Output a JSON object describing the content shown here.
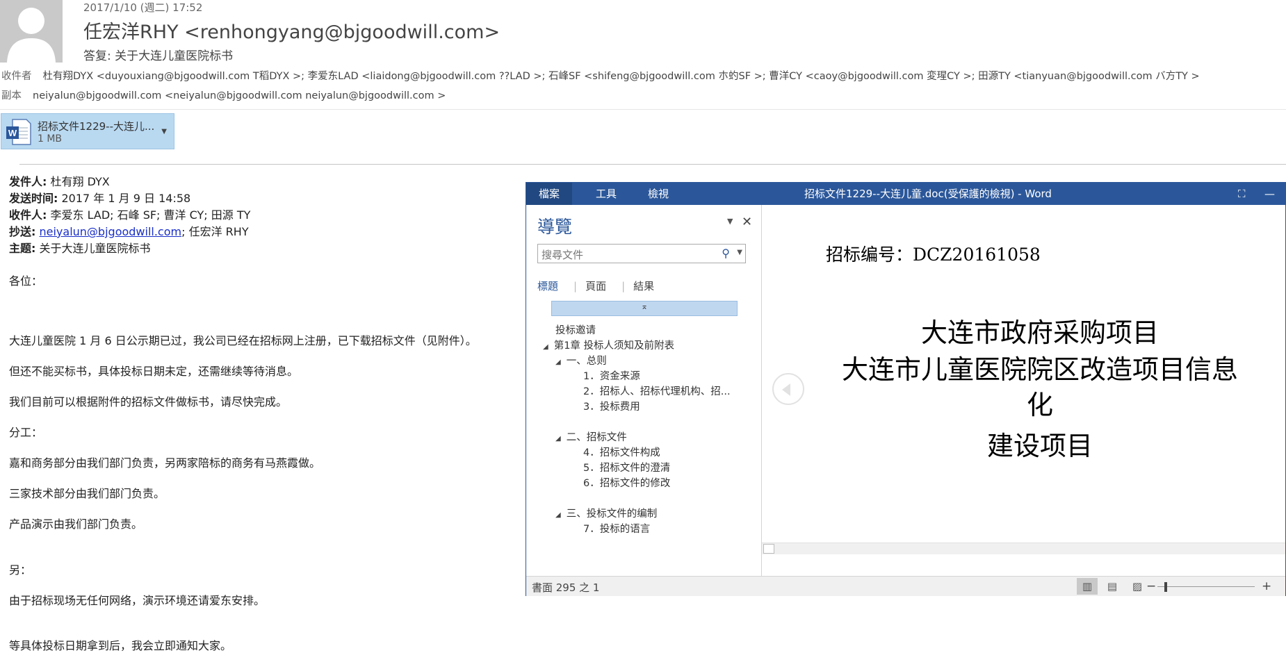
{
  "email": {
    "datetime": "2017/1/10 (週二) 17:52",
    "sender": "任宏洋RHY <renhongyang@bjgoodwill.com>",
    "subject": "答复: 关于大连儿童医院标书",
    "to_label": "收件者",
    "to_value": "杜有翔DYX <duyouxiang@bjgoodwill.com    T稻DYX >; 李爱东LAD <liaidong@bjgoodwill.com    ??LAD >; 石峰SF <shifeng@bjgoodwill.com 朩虳SF >; 曹洋CY <caoy@bjgoodwill.com 変瑆CY >; 田源TY <tianyuan@bjgoodwill.com バ方TY >",
    "cc_label": "副本",
    "cc_value": "neiyalun@bjgoodwill.com <neiyalun@bjgoodwill.com neiyalun@bjgoodwill.com >",
    "attachment": {
      "name": "招标文件1229--大连儿...",
      "size": "1 MB"
    },
    "quoted": {
      "from_label": "发件人:",
      "from": "杜有翔 DYX",
      "sent_label": "发送时间:",
      "sent": "2017 年 1 月 9 日 14:58",
      "to_label": "收件人:",
      "to": "李爱东 LAD; 石峰 SF; 曹洋 CY; 田源 TY",
      "cc_label": "抄送:",
      "cc_link": "neiyalun@bjgoodwill.com",
      "cc_rest": "; 任宏洋 RHY",
      "subject_label": "主题:",
      "subject": "关于大连儿童医院标书"
    },
    "body": [
      "各位：",
      "大连儿童医院 1 月 6 日公示期已过，我公司已经在招标网上注册，已下载招标文件（见附件）。",
      "但还不能买标书，具体投标日期未定，还需继续等待消息。",
      "我们目前可以根据附件的招标文件做标书，请尽快完成。",
      "分工：",
      "嘉和商务部分由我们部门负责，另两家陪标的商务有马燕霞做。",
      "三家技术部分由我们部门负责。",
      "产品演示由我们部门负责。",
      "另：",
      "由于招标现场无任何网络，演示环境还请爱东安排。",
      "等具体投标日期拿到后，我会立即通知大家。"
    ]
  },
  "word": {
    "tabs": [
      "檔案",
      "工具",
      "檢視"
    ],
    "title": "招标文件1229--大连儿童.doc(受保護的檢視) - Word",
    "nav": {
      "title": "導覽",
      "search_placeholder": "搜尋文件",
      "tabs": [
        "標題",
        "頁面",
        "結果"
      ],
      "items": [
        "投标邀请",
        "第1章  投标人须知及前附表",
        "一、总则",
        "1．资金来源",
        "2．招标人、招标代理机构、招...",
        "3．投标费用",
        "二、招标文件",
        "4．招标文件构成",
        "5．招标文件的澄清",
        "6．招标文件的修改",
        "三、投标文件的编制",
        "7．投标的语言"
      ]
    },
    "doc": {
      "bid_no": "招标编号：DCZ20161058",
      "line1": "大连市政府采购项目",
      "line2": "大连市儿童医院院区改造项目信息",
      "line3": "化",
      "line4": "建设项目"
    },
    "status": {
      "page": "書面 295 之 1"
    }
  }
}
